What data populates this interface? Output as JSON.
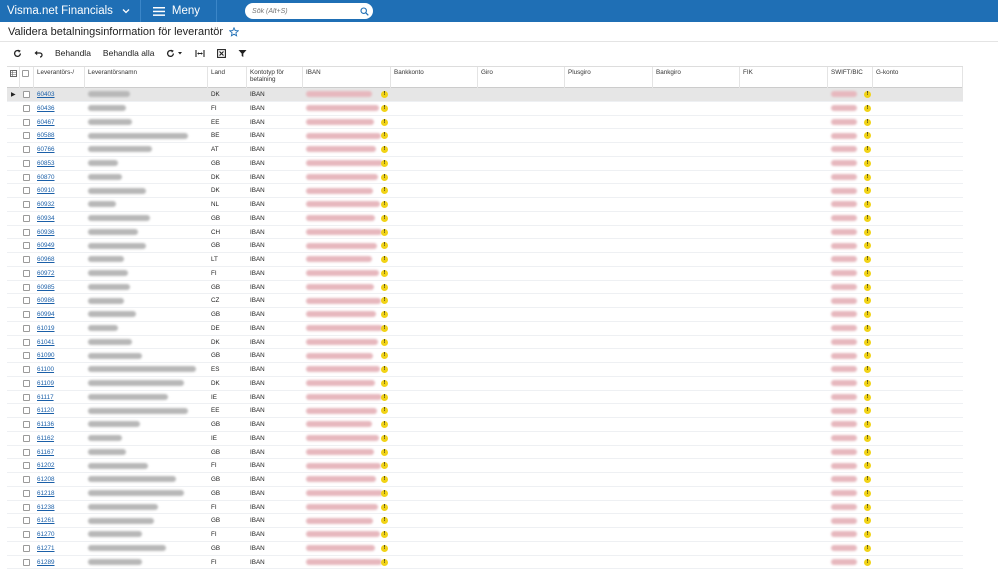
{
  "app": {
    "brand": "Visma.net Financials",
    "menu_label": "Meny"
  },
  "search": {
    "placeholder": "Sök (Alt+S)"
  },
  "page": {
    "title": "Validera betalningsinformation för leverantör"
  },
  "toolbar": {
    "process_label": "Behandla",
    "process_all_label": "Behandla alla"
  },
  "icons": {
    "brand_chevron": "chevron-down-icon",
    "menu": "hamburger-icon",
    "search": "search-icon",
    "favorite": "star-icon",
    "refresh": "refresh-icon",
    "undo": "undo-icon",
    "fit_columns": "fit-columns-icon",
    "export": "excel-export-icon",
    "filter": "filter-icon"
  },
  "colors": {
    "topbar": "#1f6fb5",
    "link": "#1a5fa8",
    "warning": "#f1d317",
    "selected_row": "#e6e6e6"
  },
  "grid": {
    "columns": {
      "supplier_no": "Leverantörs-/",
      "supplier_name": "Leverantörsnamn",
      "country": "Land",
      "account_type": "Kontotyp för betalning",
      "iban": "IBAN",
      "bank_account": "Bankkonto",
      "giro": "Giro",
      "plusgiro": "Plusgiro",
      "bankgiro": "Bankgiro",
      "fik": "FIK",
      "swift": "SWIFT/BIC",
      "g_account": "G-konto"
    },
    "rows": [
      {
        "no": "60403",
        "country": "DK",
        "type": "IBAN"
      },
      {
        "no": "60436",
        "country": "FI",
        "type": "IBAN"
      },
      {
        "no": "60467",
        "country": "EE",
        "type": "IBAN"
      },
      {
        "no": "60588",
        "country": "BE",
        "type": "IBAN"
      },
      {
        "no": "60766",
        "country": "AT",
        "type": "IBAN"
      },
      {
        "no": "60853",
        "country": "GB",
        "type": "IBAN"
      },
      {
        "no": "60870",
        "country": "DK",
        "type": "IBAN"
      },
      {
        "no": "60910",
        "country": "DK",
        "type": "IBAN"
      },
      {
        "no": "60932",
        "country": "NL",
        "type": "IBAN"
      },
      {
        "no": "60934",
        "country": "GB",
        "type": "IBAN"
      },
      {
        "no": "60936",
        "country": "CH",
        "type": "IBAN"
      },
      {
        "no": "60949",
        "country": "GB",
        "type": "IBAN"
      },
      {
        "no": "60968",
        "country": "LT",
        "type": "IBAN"
      },
      {
        "no": "60972",
        "country": "FI",
        "type": "IBAN"
      },
      {
        "no": "60985",
        "country": "GB",
        "type": "IBAN"
      },
      {
        "no": "60986",
        "country": "CZ",
        "type": "IBAN"
      },
      {
        "no": "60994",
        "country": "GB",
        "type": "IBAN"
      },
      {
        "no": "61019",
        "country": "DE",
        "type": "IBAN"
      },
      {
        "no": "61041",
        "country": "DK",
        "type": "IBAN"
      },
      {
        "no": "61090",
        "country": "GB",
        "type": "IBAN"
      },
      {
        "no": "61100",
        "country": "ES",
        "type": "IBAN"
      },
      {
        "no": "61109",
        "country": "DK",
        "type": "IBAN"
      },
      {
        "no": "61117",
        "country": "IE",
        "type": "IBAN"
      },
      {
        "no": "61120",
        "country": "EE",
        "type": "IBAN"
      },
      {
        "no": "61136",
        "country": "GB",
        "type": "IBAN"
      },
      {
        "no": "61162",
        "country": "IE",
        "type": "IBAN"
      },
      {
        "no": "61167",
        "country": "GB",
        "type": "IBAN"
      },
      {
        "no": "61202",
        "country": "FI",
        "type": "IBAN"
      },
      {
        "no": "61208",
        "country": "GB",
        "type": "IBAN"
      },
      {
        "no": "61218",
        "country": "GB",
        "type": "IBAN"
      },
      {
        "no": "61238",
        "country": "FI",
        "type": "IBAN"
      },
      {
        "no": "61261",
        "country": "GB",
        "type": "IBAN"
      },
      {
        "no": "61270",
        "country": "FI",
        "type": "IBAN"
      },
      {
        "no": "61271",
        "country": "GB",
        "type": "IBAN"
      },
      {
        "no": "61289",
        "country": "FI",
        "type": "IBAN"
      }
    ]
  }
}
